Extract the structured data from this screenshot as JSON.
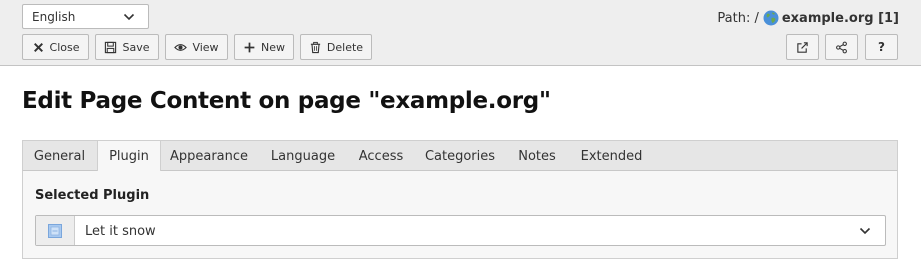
{
  "language_select": {
    "value": "English"
  },
  "path": {
    "label": "Path: /",
    "site": "example.org [1]"
  },
  "toolbar": {
    "close_label": "Close",
    "save_label": "Save",
    "view_label": "View",
    "new_label": "New",
    "delete_label": "Delete",
    "help_label": "?"
  },
  "page_title": "Edit Page Content on page \"example.org\"",
  "tabs": [
    {
      "label": "General"
    },
    {
      "label": "Plugin"
    },
    {
      "label": "Appearance"
    },
    {
      "label": "Language"
    },
    {
      "label": "Access"
    },
    {
      "label": "Categories"
    },
    {
      "label": "Notes"
    },
    {
      "label": "Extended"
    }
  ],
  "active_tab": "Plugin",
  "plugin_panel": {
    "field_label": "Selected Plugin",
    "selected_value": "Let it snow"
  },
  "icons": {
    "dropdown": "chevron-down-icon",
    "globe": "globe-icon",
    "close": "close-icon",
    "save": "save-icon",
    "view": "eye-icon",
    "new": "plus-icon",
    "delete": "trash-icon",
    "external": "external-link-icon",
    "share": "share-icon",
    "plugin": "plugin-icon"
  }
}
